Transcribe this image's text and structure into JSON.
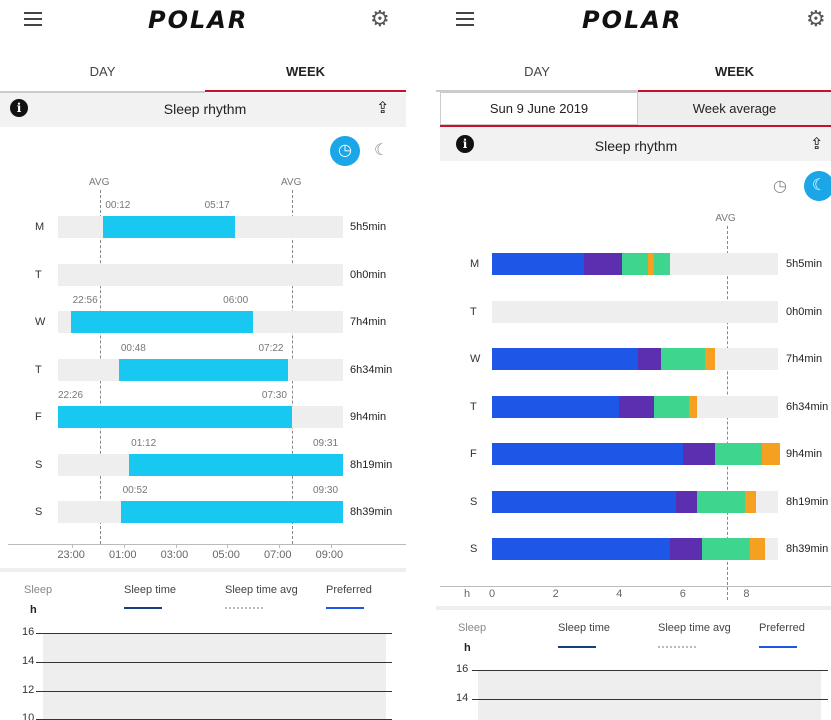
{
  "app": {
    "logo": "POLAR"
  },
  "left": {
    "tabs": [
      {
        "label": "DAY"
      },
      {
        "label": "WEEK"
      }
    ],
    "title": "Sleep rhythm",
    "avg_label": "AVG",
    "days": [
      {
        "day": "M",
        "start": "00:12",
        "end": "05:17",
        "duration": "5h5min",
        "s": 0.2,
        "e": 5.283
      },
      {
        "day": "T",
        "start": "",
        "end": "",
        "duration": "0h0min",
        "s": null,
        "e": null
      },
      {
        "day": "W",
        "start": "22:56",
        "end": "06:00",
        "duration": "7h4min",
        "s": -1.067,
        "e": 6.0
      },
      {
        "day": "T",
        "start": "00:48",
        "end": "07:22",
        "duration": "6h34min",
        "s": 0.8,
        "e": 7.367
      },
      {
        "day": "F",
        "start": "22:26",
        "end": "07:30",
        "duration": "9h4min",
        "s": -1.567,
        "e": 7.5
      },
      {
        "day": "S",
        "start": "01:12",
        "end": "09:31",
        "duration": "8h19min",
        "s": 1.2,
        "e": 9.517
      },
      {
        "day": "S",
        "start": "00:52",
        "end": "09:30",
        "duration": "8h39min",
        "s": 0.867,
        "e": 9.5
      }
    ],
    "time_axis": [
      "23:00",
      "01:00",
      "03:00",
      "05:00",
      "07:00",
      "09:00"
    ],
    "legend": {
      "sleep": "Sleep",
      "unit": "h",
      "sleep_time": "Sleep time",
      "sleep_time_avg": "Sleep time avg",
      "preferred": "Preferred"
    },
    "yticks": [
      "16",
      "14",
      "12",
      "10"
    ]
  },
  "right": {
    "tabs": [
      {
        "label": "DAY"
      },
      {
        "label": "WEEK"
      }
    ],
    "subtabs": [
      {
        "label": "Sun 9 June 2019"
      },
      {
        "label": "Week average"
      }
    ],
    "title": "Sleep rhythm",
    "avg_label": "AVG",
    "avg_value": 7.4,
    "xmax": 9.0,
    "colors": {
      "deep": "#1e56e8",
      "light": "#5b2fb0",
      "rem": "#3ed68f",
      "awake": "#f5a020"
    },
    "days": [
      {
        "day": "M",
        "duration": "5h5min",
        "segs": [
          2.9,
          1.2,
          0.8,
          0.2,
          0.5
        ]
      },
      {
        "day": "T",
        "duration": "0h0min",
        "segs": []
      },
      {
        "day": "W",
        "duration": "7h4min",
        "segs": [
          4.6,
          0.7,
          1.4,
          0.3
        ]
      },
      {
        "day": "T",
        "duration": "6h34min",
        "segs": [
          4.0,
          1.1,
          1.1,
          0.25
        ]
      },
      {
        "day": "F",
        "duration": "9h4min",
        "segs": [
          6.0,
          1.0,
          1.5,
          0.55
        ]
      },
      {
        "day": "S",
        "duration": "8h19min",
        "segs": [
          5.8,
          0.65,
          1.5,
          0.35
        ]
      },
      {
        "day": "S",
        "duration": "8h39min",
        "segs": [
          5.6,
          1.0,
          1.5,
          0.5
        ]
      }
    ],
    "axis_unit": "h",
    "axis_ticks": [
      "0",
      "2",
      "4",
      "6",
      "8"
    ],
    "legend": {
      "sleep": "Sleep",
      "unit": "h",
      "sleep_time": "Sleep time",
      "sleep_time_avg": "Sleep time avg",
      "preferred": "Preferred"
    },
    "yticks": [
      "16",
      "14"
    ]
  }
}
